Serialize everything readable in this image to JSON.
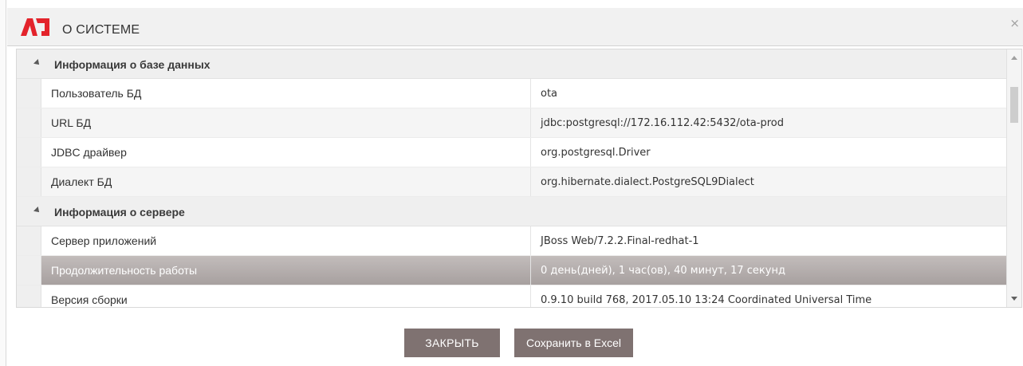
{
  "dialog": {
    "title": "О СИСТЕМЕ",
    "close_glyph": "×",
    "logo_icon": "app-logo-icon",
    "accent_color": "#e3232b"
  },
  "grid": {
    "groups": [
      {
        "label": "Информация о базе данных",
        "rows": [
          {
            "name": "Пользователь БД",
            "value": "ota"
          },
          {
            "name": "URL БД",
            "value": "jdbc:postgresql://172.16.112.42:5432/ota-prod"
          },
          {
            "name": "JDBC драйвер",
            "value": "org.postgresql.Driver"
          },
          {
            "name": "Диалект БД",
            "value": "org.hibernate.dialect.PostgreSQL9Dialect"
          }
        ]
      },
      {
        "label": "Информация о сервере",
        "rows": [
          {
            "name": "Сервер приложений",
            "value": "JBoss Web/7.2.2.Final-redhat-1"
          },
          {
            "name": "Продолжительность работы",
            "value": "0 день(дней), 1 час(ов), 40 минут, 17 секунд"
          },
          {
            "name": "Версия сборки",
            "value": "0.9.10 build 768, 2017.05.10 13:24 Coordinated Universal Time"
          }
        ]
      }
    ],
    "selected_row": "Продолжительность работы"
  },
  "buttons": {
    "close_label": "ЗАКРЫТЬ",
    "excel_label": "Сохранить в Excel",
    "button_color": "#7f7271"
  }
}
